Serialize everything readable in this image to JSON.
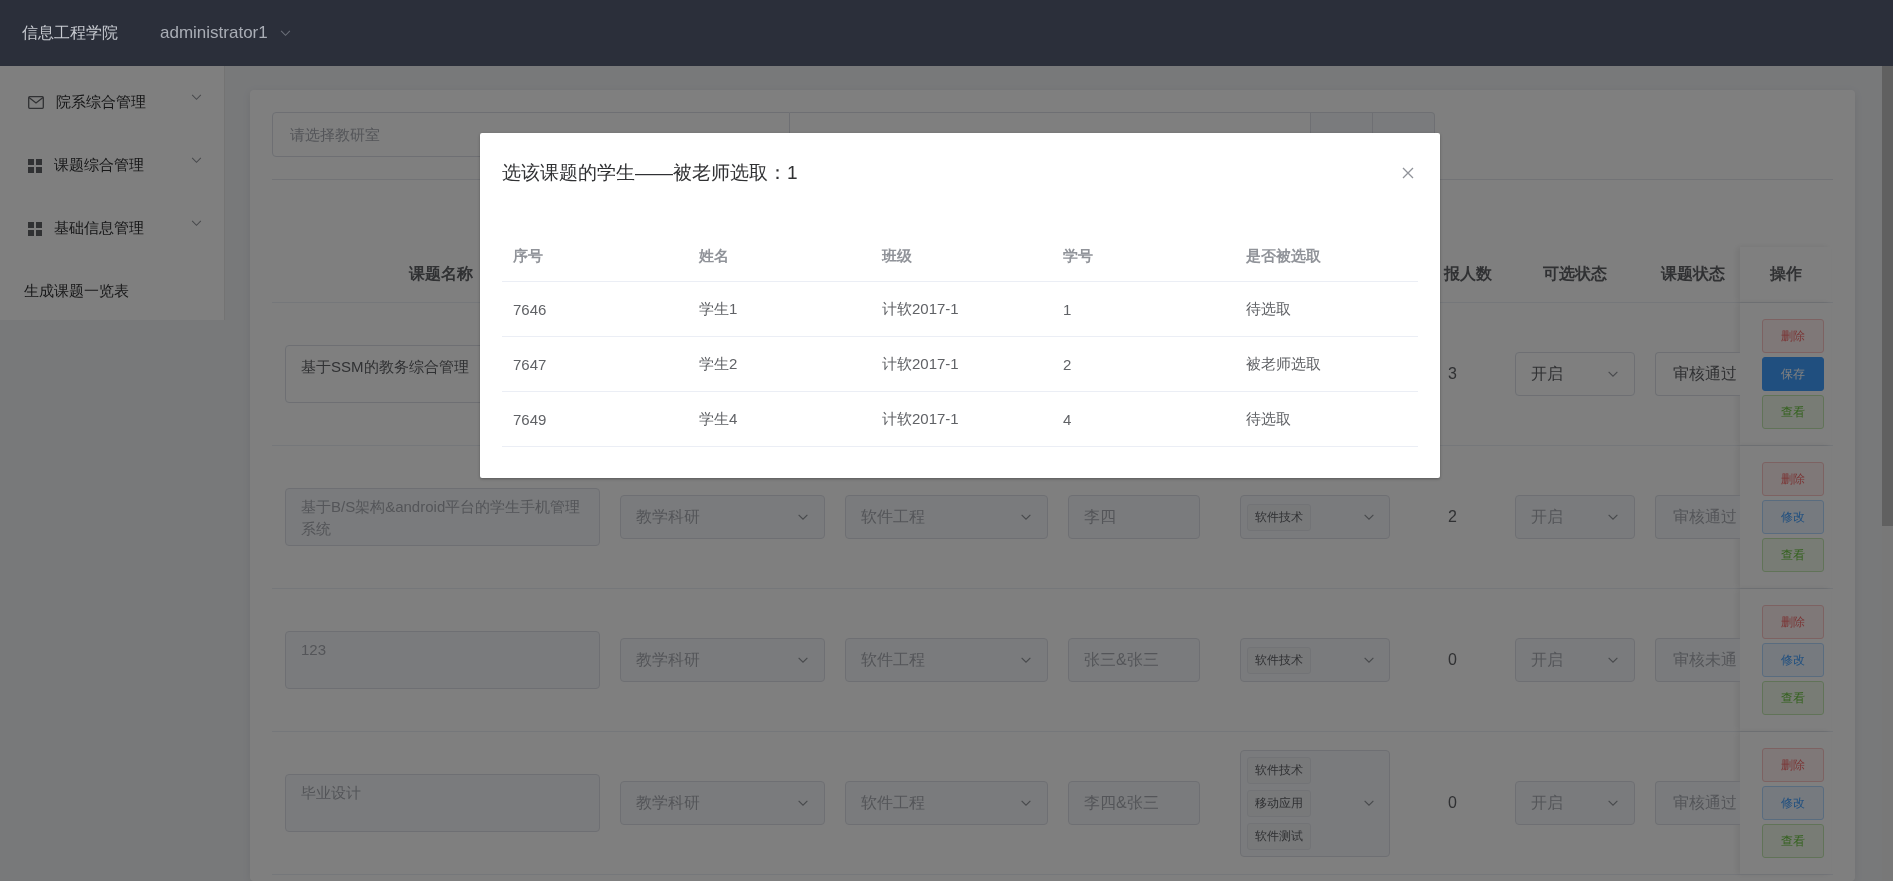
{
  "header": {
    "brand": "信息工程学院",
    "user": "administrator1"
  },
  "sidebar": {
    "items": [
      {
        "label": "院系综合管理",
        "kind": "submenu"
      },
      {
        "label": "课题综合管理",
        "kind": "submenu"
      },
      {
        "label": "基础信息管理",
        "kind": "submenu"
      },
      {
        "label": "生成课题一览表",
        "kind": "link"
      }
    ]
  },
  "filters": {
    "department": {
      "placeholder": "请选择教研室"
    }
  },
  "table": {
    "columns": [
      {
        "label": "课题名称"
      },
      {
        "label": "报人数"
      },
      {
        "label": "可选状态"
      },
      {
        "label": "课题状态"
      },
      {
        "label": "操作"
      }
    ],
    "rows": [
      {
        "title": "基于SSM的教务综合管理",
        "editing": true,
        "count": "3",
        "availability": "开启",
        "status": "审核通过",
        "actions": [
          {
            "label": "删除",
            "kind": "danger"
          },
          {
            "label": "保存",
            "kind": "primary"
          },
          {
            "label": "查看",
            "kind": "success"
          }
        ]
      },
      {
        "title": "基于B/S架构&android平台的学生手机管理系统",
        "editing": false,
        "section": "教学科研",
        "major": "软件工程",
        "teacher": "李四",
        "tags": [
          "软件技术"
        ],
        "count": "2",
        "availability": "开启",
        "status": "审核通过",
        "actions": [
          {
            "label": "删除",
            "kind": "danger"
          },
          {
            "label": "修改",
            "kind": "plain"
          },
          {
            "label": "查看",
            "kind": "success"
          }
        ]
      },
      {
        "title": "123",
        "editing": false,
        "section": "教学科研",
        "major": "软件工程",
        "teacher": "张三&张三",
        "tags": [
          "软件技术"
        ],
        "count": "0",
        "availability": "开启",
        "status": "审核未通",
        "actions": [
          {
            "label": "删除",
            "kind": "danger"
          },
          {
            "label": "修改",
            "kind": "plain"
          },
          {
            "label": "查看",
            "kind": "success"
          }
        ]
      },
      {
        "title": "毕业设计",
        "editing": false,
        "section": "教学科研",
        "major": "软件工程",
        "teacher": "李四&张三",
        "tags": [
          "软件技术",
          "移动应用",
          "软件测试"
        ],
        "count": "0",
        "availability": "开启",
        "status": "审核通过",
        "actions": [
          {
            "label": "删除",
            "kind": "danger"
          },
          {
            "label": "修改",
            "kind": "plain"
          },
          {
            "label": "查看",
            "kind": "success"
          }
        ]
      }
    ]
  },
  "modal": {
    "title": "选该课题的学生——被老师选取：1",
    "columns": [
      "序号",
      "姓名",
      "班级",
      "学号",
      "是否被选取"
    ],
    "rows": [
      [
        "7646",
        "学生1",
        "计软2017-1",
        "1",
        "待选取"
      ],
      [
        "7647",
        "学生2",
        "计软2017-1",
        "2",
        "被老师选取"
      ],
      [
        "7649",
        "学生4",
        "计软2017-1",
        "4",
        "待选取"
      ]
    ]
  }
}
